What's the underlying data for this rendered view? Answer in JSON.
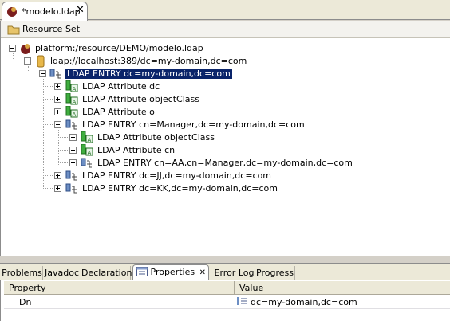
{
  "editor": {
    "tab_label": "*modelo.ldap",
    "close_glyph": "✕",
    "resource_header": "Resource Set",
    "tree": [
      {
        "id": "n0",
        "label": "platform:/resource/DEMO/modelo.ldap",
        "icon": "platform-icon",
        "expanded": true
      },
      {
        "id": "n1",
        "label": "ldap://localhost:389/dc=my-domain,dc=com",
        "icon": "server-icon",
        "expanded": true
      },
      {
        "id": "n2",
        "label": "LDAP ENTRY dc=my-domain,dc=com",
        "icon": "ldap-entry-icon",
        "expanded": true,
        "selected": true
      },
      {
        "id": "n3",
        "label": "LDAP Attribute dc",
        "icon": "ldap-attribute-icon",
        "expanded": false
      },
      {
        "id": "n4",
        "label": "LDAP Attribute objectClass",
        "icon": "ldap-attribute-icon",
        "expanded": false
      },
      {
        "id": "n5",
        "label": "LDAP Attribute o",
        "icon": "ldap-attribute-icon",
        "expanded": false
      },
      {
        "id": "n6",
        "label": "LDAP ENTRY cn=Manager,dc=my-domain,dc=com",
        "icon": "ldap-entry-icon",
        "expanded": true
      },
      {
        "id": "n7",
        "label": "LDAP Attribute objectClass",
        "icon": "ldap-attribute-icon",
        "expanded": false
      },
      {
        "id": "n8",
        "label": "LDAP Attribute cn",
        "icon": "ldap-attribute-icon",
        "expanded": false
      },
      {
        "id": "n9",
        "label": "LDAP ENTRY cn=AA,cn=Manager,dc=my-domain,dc=com",
        "icon": "ldap-entry-icon",
        "expanded": false
      },
      {
        "id": "n10",
        "label": "LDAP ENTRY dc=JJ,dc=my-domain,dc=com",
        "icon": "ldap-entry-icon",
        "expanded": false
      },
      {
        "id": "n11",
        "label": "LDAP ENTRY dc=KK,dc=my-domain,dc=com",
        "icon": "ldap-entry-icon",
        "expanded": false
      }
    ]
  },
  "views": {
    "tabs": [
      {
        "label": "Problems"
      },
      {
        "label": "Javadoc"
      },
      {
        "label": "Declaration"
      },
      {
        "label": "Properties",
        "active": true,
        "icon": "properties-icon"
      },
      {
        "label": "Error Log"
      },
      {
        "label": "Progress"
      }
    ]
  },
  "properties": {
    "col_property": "Property",
    "col_value": "Value",
    "rows": [
      {
        "property": "Dn",
        "value": "dc=my-domain,dc=com"
      }
    ]
  },
  "colors": {
    "selection": "#0a246a",
    "chrome": "#d4d0c8",
    "attribute_green": "#3fae3f",
    "entry_blue": "#6d8fc4"
  }
}
